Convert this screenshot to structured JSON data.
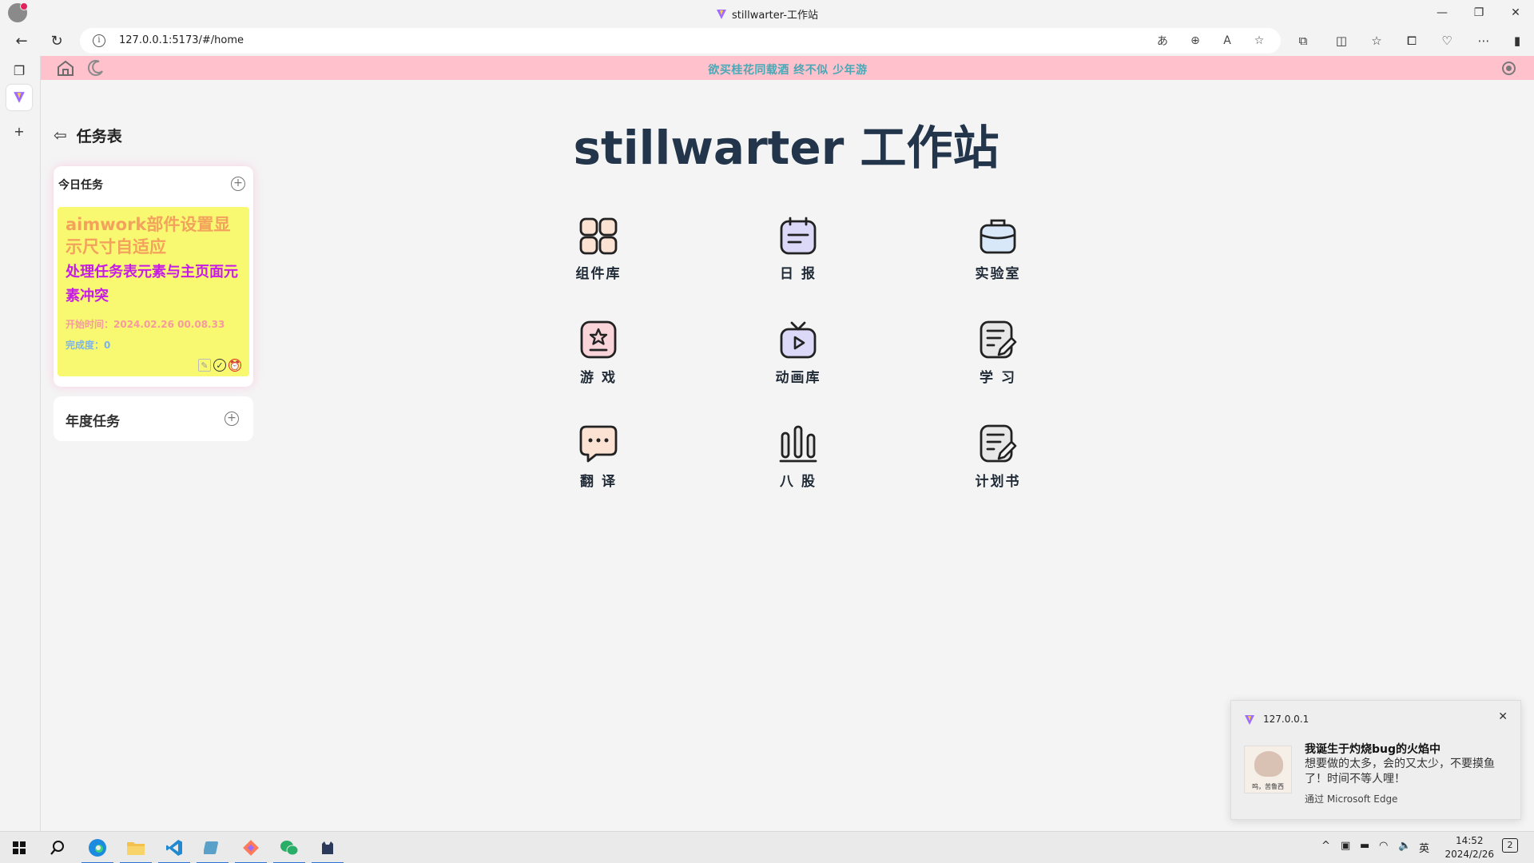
{
  "browser": {
    "window_title": "stillwarter-工作站",
    "url": "127.0.0.1:5173/#/home"
  },
  "page": {
    "banner_text": "欲买桂花同载酒 终不似 少年游",
    "main_title": "stillwarter 工作站",
    "sidebar": {
      "title": "任务表",
      "today": {
        "label": "今日任务",
        "task_title": "aimwork部件设置显示尺寸自适应",
        "task_detail": "处理任务表元素与主页面元素冲突",
        "start_time": "开始时间：2024.02.26 00.08.33",
        "progress": "完成度：0"
      },
      "year": {
        "label": "年度任务"
      }
    },
    "grid": [
      {
        "label": "组件库",
        "icon": "grid-icon"
      },
      {
        "label": "日 报",
        "icon": "calendar-icon"
      },
      {
        "label": "实验室",
        "icon": "briefcase-icon"
      },
      {
        "label": "游 戏",
        "icon": "star-icon"
      },
      {
        "label": "动画库",
        "icon": "tv-play-icon"
      },
      {
        "label": "学 习",
        "icon": "note-edit-icon"
      },
      {
        "label": "翻 译",
        "icon": "chat-icon"
      },
      {
        "label": "八 股",
        "icon": "bars-icon"
      },
      {
        "label": "计划书",
        "icon": "plan-edit-icon"
      }
    ]
  },
  "notification": {
    "source": "127.0.0.1",
    "title": "我诞生于灼烧bug的火焰中",
    "body": "想要做的太多，会的又太少，不要摸鱼了！时间不等人哩！",
    "via": "通过 Microsoft Edge",
    "image_caption": "呜，苦鲁西"
  },
  "taskbar": {
    "ime": "英",
    "time": "14:52",
    "date": "2024/2/26",
    "notification_count": "2"
  },
  "colors": {
    "banner_bg": "#ffc1cc",
    "sticky_bg": "#f9f971",
    "title": "#23354b"
  }
}
